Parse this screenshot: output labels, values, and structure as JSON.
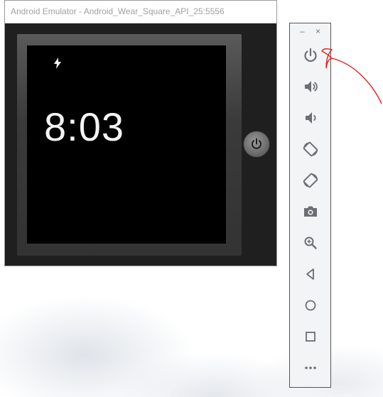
{
  "window": {
    "title": "Android Emulator - Android_Wear_Square_API_25:5556"
  },
  "device": {
    "time": "8:03",
    "status_icon": "bolt-icon"
  },
  "toolbar": {
    "minimize_label": "–",
    "close_label": "×",
    "buttons": [
      "power-icon",
      "volume-up-icon",
      "volume-down-icon",
      "rotate-left-icon",
      "rotate-right-icon",
      "camera-icon",
      "zoom-icon",
      "back-icon",
      "home-icon",
      "overview-icon",
      "more-icon"
    ]
  },
  "colors": {
    "icon": "#6b6f74",
    "annotation": "#e0211b"
  }
}
